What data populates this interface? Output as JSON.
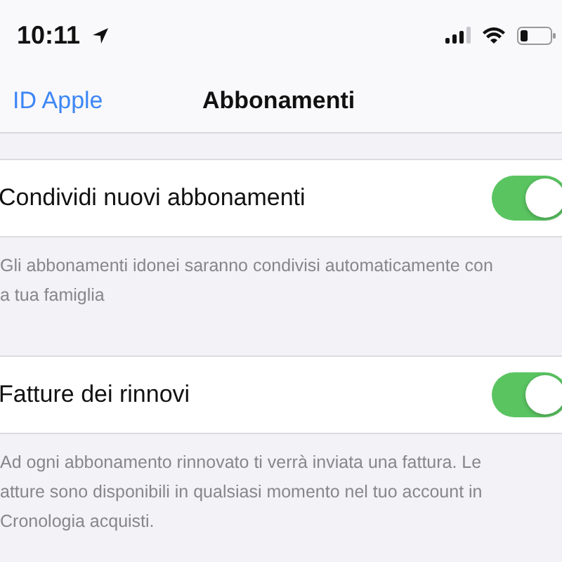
{
  "status_bar": {
    "time": "10:11"
  },
  "nav": {
    "back": "ID Apple",
    "title": "Abbonamenti"
  },
  "sections": [
    {
      "label": "Condividi nuovi abbonamenti",
      "on": true,
      "footer_lines": [
        "Gli abbonamenti idonei saranno condivisi automaticamente con",
        "a tua famiglia"
      ]
    },
    {
      "label": "Fatture dei rinnovi",
      "on": true,
      "footer_lines": [
        "Ad ogni abbonamento rinnovato ti verrà inviata una fattura. Le",
        "atture sono disponibili in qualsiasi momento nel tuo account in",
        "Cronologia acquisti."
      ]
    }
  ]
}
